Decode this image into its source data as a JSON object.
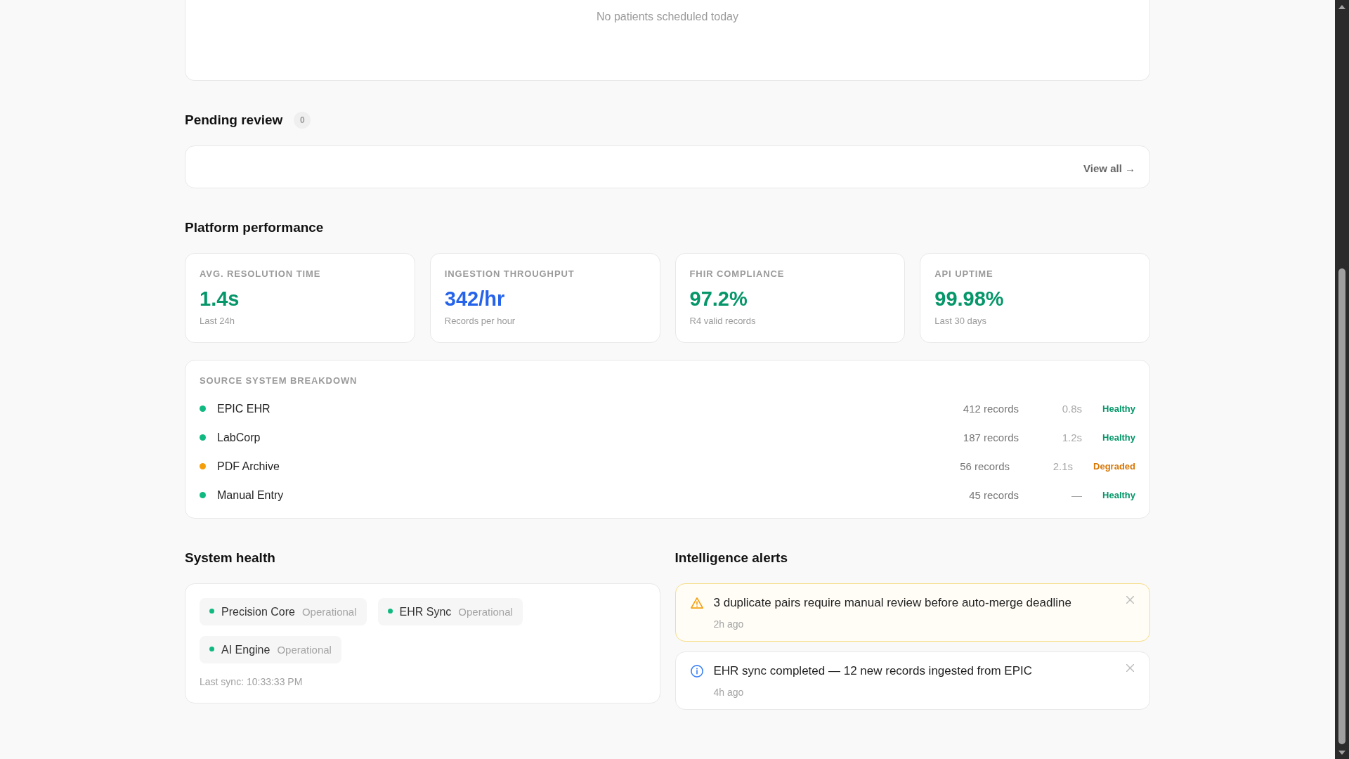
{
  "schedule": {
    "empty_message": "No patients scheduled today"
  },
  "pending_review": {
    "title": "Pending review",
    "count": "0",
    "link": "View all →"
  },
  "platform_performance": {
    "title": "Platform performance",
    "metrics": [
      {
        "label": "AVG. RESOLUTION TIME",
        "value": "1.4s",
        "caption": "Last 24h",
        "color": "#059669"
      },
      {
        "label": "INGESTION THROUGHPUT",
        "value": "342/hr",
        "caption": "Records per hour",
        "color": "#2563eb"
      },
      {
        "label": "FHIR COMPLIANCE",
        "value": "97.2%",
        "caption": "R4 valid records",
        "color": "#059669"
      },
      {
        "label": "API UPTIME",
        "value": "99.98%",
        "caption": "Last 30 days",
        "color": "#059669"
      }
    ],
    "source_breakdown": {
      "title": "SOURCE SYSTEM BREAKDOWN",
      "sources": [
        {
          "name": "EPIC EHR",
          "records": "412 records",
          "latency": "0.8s",
          "status": "Healthy",
          "degraded": false,
          "color": "#10b981"
        },
        {
          "name": "LabCorp",
          "records": "187 records",
          "latency": "1.2s",
          "status": "Healthy",
          "degraded": false,
          "color": "#10b981"
        },
        {
          "name": "PDF Archive",
          "records": "56 records",
          "latency": "2.1s",
          "status": "Degraded",
          "degraded": true,
          "color": "#f59e0b"
        },
        {
          "name": "Manual Entry",
          "records": "45 records",
          "latency": "—",
          "status": "Healthy",
          "degraded": false,
          "color": "#10b981"
        }
      ]
    }
  },
  "system_health": {
    "title": "System health",
    "services": [
      {
        "name": "Precision Core",
        "status": "Operational",
        "color": "#10b981"
      },
      {
        "name": "EHR Sync",
        "status": "Operational",
        "color": "#10b981"
      },
      {
        "name": "AI Engine",
        "status": "Operational",
        "color": "#10b981"
      }
    ],
    "last_sync": "Last sync: 10:33:33 PM"
  },
  "intelligence_alerts": {
    "title": "Intelligence alerts",
    "alerts": [
      {
        "kind": "warning",
        "message": "3 duplicate pairs require manual review before auto-merge deadline",
        "time": "2h ago"
      },
      {
        "kind": "info",
        "message": "EHR sync completed — 12 new records ingested from EPIC",
        "time": "4h ago"
      }
    ]
  }
}
